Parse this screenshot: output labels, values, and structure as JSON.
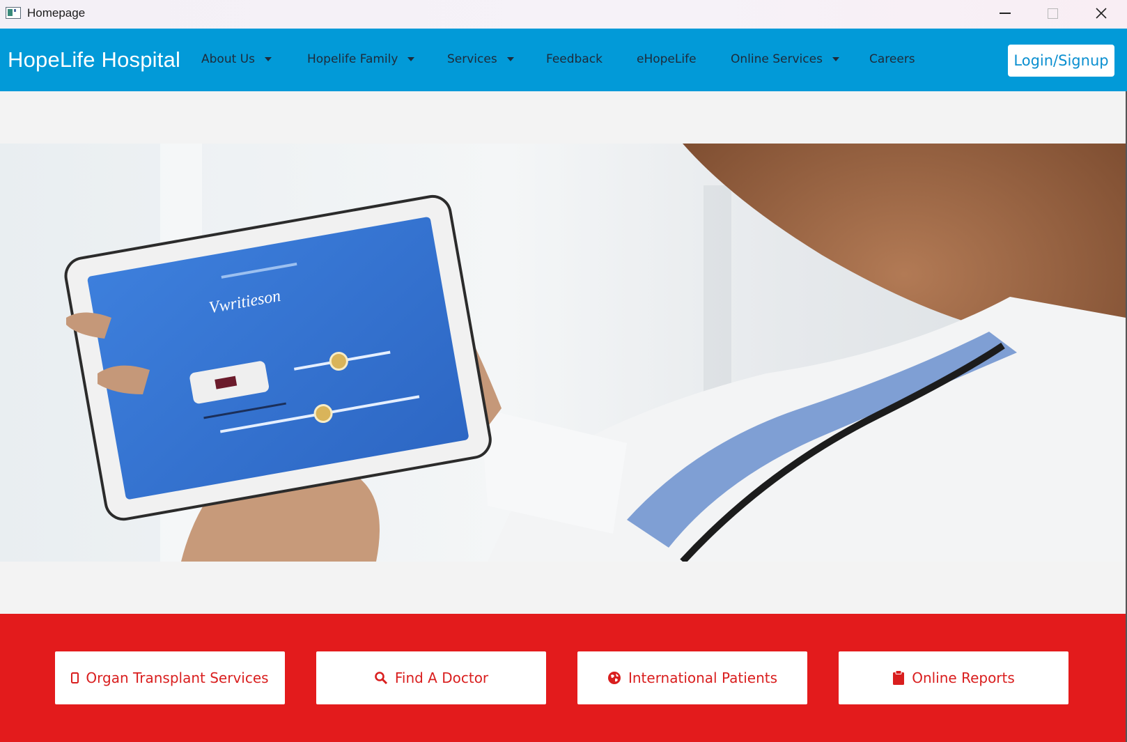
{
  "window": {
    "title": "Homepage",
    "controls": [
      "minimize",
      "maximize",
      "close"
    ]
  },
  "navbar": {
    "brand": "HopeLife Hospital",
    "items": [
      {
        "label": "About Us",
        "dropdown": true
      },
      {
        "label": "Hopelife Family",
        "dropdown": true
      },
      {
        "label": "Services",
        "dropdown": true
      },
      {
        "label": "Feedback",
        "dropdown": false
      },
      {
        "label": "eHopeLife",
        "dropdown": false
      },
      {
        "label": "Online Services",
        "dropdown": true
      },
      {
        "label": "Careers",
        "dropdown": false
      }
    ],
    "login_label": "Login/Signup"
  },
  "hero": {
    "image_subject": "doctor holding tablet",
    "tablet_screen_text": "Vwritieson"
  },
  "quick_links": [
    {
      "label": "Organ Transplant Services",
      "icon": "mobile-icon"
    },
    {
      "label": "Find A Doctor",
      "icon": "search-icon"
    },
    {
      "label": "International Patients",
      "icon": "globe-icon"
    },
    {
      "label": "Online Reports",
      "icon": "clipboard-icon"
    }
  ],
  "colors": {
    "navbar": "#029ad8",
    "quicklinks_band": "#e31b1c",
    "quicklink_text": "#d91e1e",
    "login_text": "#0a8fd0"
  }
}
